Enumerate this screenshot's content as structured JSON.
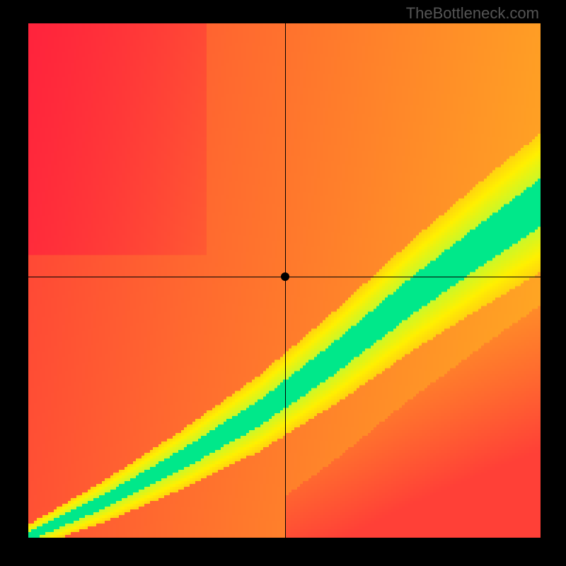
{
  "watermark": "TheBottleneck.com",
  "chart_data": {
    "type": "heatmap",
    "title": "",
    "xlabel": "",
    "ylabel": "",
    "xlim": [
      0,
      1
    ],
    "ylim": [
      0,
      1
    ],
    "marker": {
      "x": 0.502,
      "y": 0.508
    },
    "crosshair": {
      "x": 0.502,
      "y": 0.508
    },
    "colormap": {
      "description": "red-orange-yellow-green diverging",
      "stops": [
        {
          "value": 0.0,
          "color": "#ff193e"
        },
        {
          "value": 0.25,
          "color": "#ff6a2f"
        },
        {
          "value": 0.5,
          "color": "#ffb320"
        },
        {
          "value": 0.7,
          "color": "#fff000"
        },
        {
          "value": 0.85,
          "color": "#c8f82a"
        },
        {
          "value": 1.0,
          "color": "#00e88a"
        }
      ]
    },
    "value_function": "Green diagonal band follows curve from (0,0) to (1,~0.65); value = 1 - clamp(distance_from_band / bandwidth). Background gradient: upper-left red, transitioning through orange/yellow toward upper-right and lower-right.",
    "band_control_points": [
      {
        "x": 0.0,
        "y": 0.0
      },
      {
        "x": 0.15,
        "y": 0.07
      },
      {
        "x": 0.3,
        "y": 0.15
      },
      {
        "x": 0.45,
        "y": 0.24
      },
      {
        "x": 0.6,
        "y": 0.35
      },
      {
        "x": 0.75,
        "y": 0.47
      },
      {
        "x": 0.9,
        "y": 0.58
      },
      {
        "x": 1.0,
        "y": 0.65
      }
    ],
    "band_width": 0.05
  }
}
